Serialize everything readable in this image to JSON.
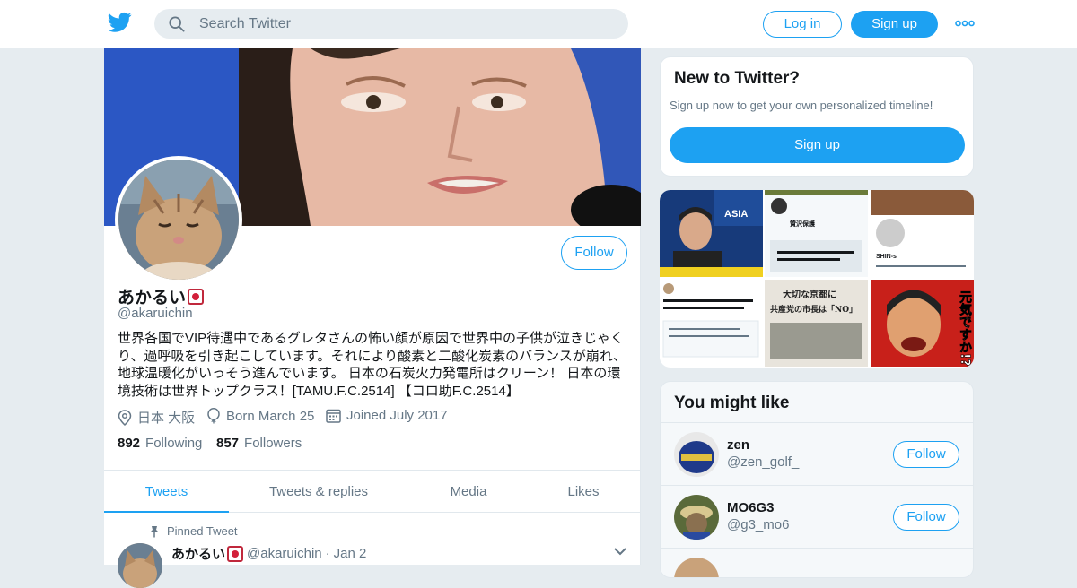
{
  "header": {
    "search_placeholder": "Search Twitter",
    "login_label": "Log in",
    "signup_label": "Sign up",
    "more_icon": "more-dots-icon",
    "logo_icon": "twitter-bird-icon",
    "accent": "#1da1f2"
  },
  "profile": {
    "name": "あかるい",
    "handle": "@akaruichin",
    "bio": "世界各国でVIP待遇中であるグレタさんの怖い顔が原因で世界中の子供が泣きじゃくり、過呼吸を引き起こしています。それにより酸素と二酸化炭素のバランスが崩れ、地球温暖化がいっそう進んでいます。 日本の石炭火力発電所はクリーン！ 日本の環境技術は世界トップクラス！[TAMU.F.C.2514] 【コロ助F.C.2514】",
    "location": "日本 大阪",
    "birthday": "Born March 25",
    "joined": "Joined July 2017",
    "following_count": "892",
    "following_label": "Following",
    "followers_count": "857",
    "followers_label": "Followers",
    "follow_label": "Follow"
  },
  "tabs": [
    {
      "label": "Tweets",
      "active": true
    },
    {
      "label": "Tweets & replies",
      "active": false
    },
    {
      "label": "Media",
      "active": false
    },
    {
      "label": "Likes",
      "active": false
    }
  ],
  "pinned_tweet": {
    "pinned_label": "Pinned Tweet",
    "author": "あかるい",
    "handle": "@akaruichin",
    "separator": "·",
    "date": "Jan 2"
  },
  "new_to_twitter": {
    "title": "New to Twitter?",
    "subtitle": "Sign up now to get your own personalized timeline!",
    "signup_label": "Sign up"
  },
  "media_grid": {
    "texts": [
      "ASIA",
      "贊沢保護",
      "SHIN-s",
      "大切な京都に",
      "共産党の市長は「NO」",
      "元気ですか!?"
    ]
  },
  "you_might_like": {
    "title": "You might like",
    "users": [
      {
        "name": "zen",
        "handle": "@zen_golf_",
        "follow_label": "Follow"
      },
      {
        "name": "MO6G3",
        "handle": "@g3_mo6",
        "follow_label": "Follow"
      }
    ]
  }
}
